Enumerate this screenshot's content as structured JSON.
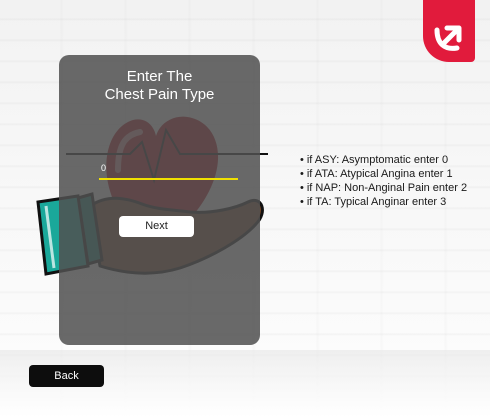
{
  "form": {
    "title_line1": "Enter The",
    "title_line2": "Chest Pain Type",
    "input_value": "0",
    "next_label": "Next"
  },
  "help": {
    "items": [
      "if ASY: Asymptomatic enter 0",
      "if ATA: Atypical Angina enter 1",
      "if NAP: Non-Anginal Pain enter 2",
      "if TA: Typical Anginar enter 3"
    ]
  },
  "nav": {
    "back_label": "Back"
  },
  "colors": {
    "accent_badge": "#e11b3c",
    "heart": "#b0141f",
    "hand_skin": "#7a4a2a",
    "cuff": "#1aa89a",
    "input_underline": "#f0e000",
    "card_overlay": "#505050"
  },
  "icons": {
    "logo": "up-right-arrow-icon",
    "illustration": "heart-in-hand-icon"
  }
}
